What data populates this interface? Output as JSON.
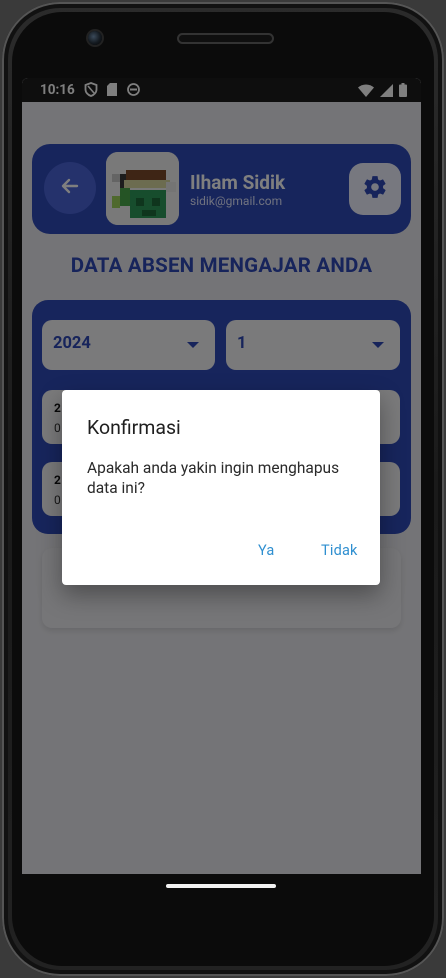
{
  "status_bar": {
    "time": "10:16",
    "left_icons": [
      "shield-icon",
      "sd-card-icon",
      "sync-icon"
    ],
    "right_icons": [
      "wifi-icon",
      "signal-icon",
      "battery-icon"
    ]
  },
  "header": {
    "user_name": "Ilham Sidik",
    "user_email": "sidik@gmail.com"
  },
  "page": {
    "title": "DATA ABSEN MENGAJAR ANDA"
  },
  "filters": {
    "year": "2024",
    "month": "1"
  },
  "dialog": {
    "title": "Konfirmasi",
    "message": "Apakah anda yakin ingin menghapus data ini?",
    "yes_label": "Ya",
    "no_label": "Tidak"
  },
  "records": [
    {
      "date_fragment": "2",
      "time_fragment": "0"
    },
    {
      "date_fragment": "2",
      "time_fragment": "0"
    }
  ],
  "colors": {
    "primary": "#2f4ab8",
    "accent_text": "#2f49b6",
    "dialog_button": "#2f8fd0"
  }
}
